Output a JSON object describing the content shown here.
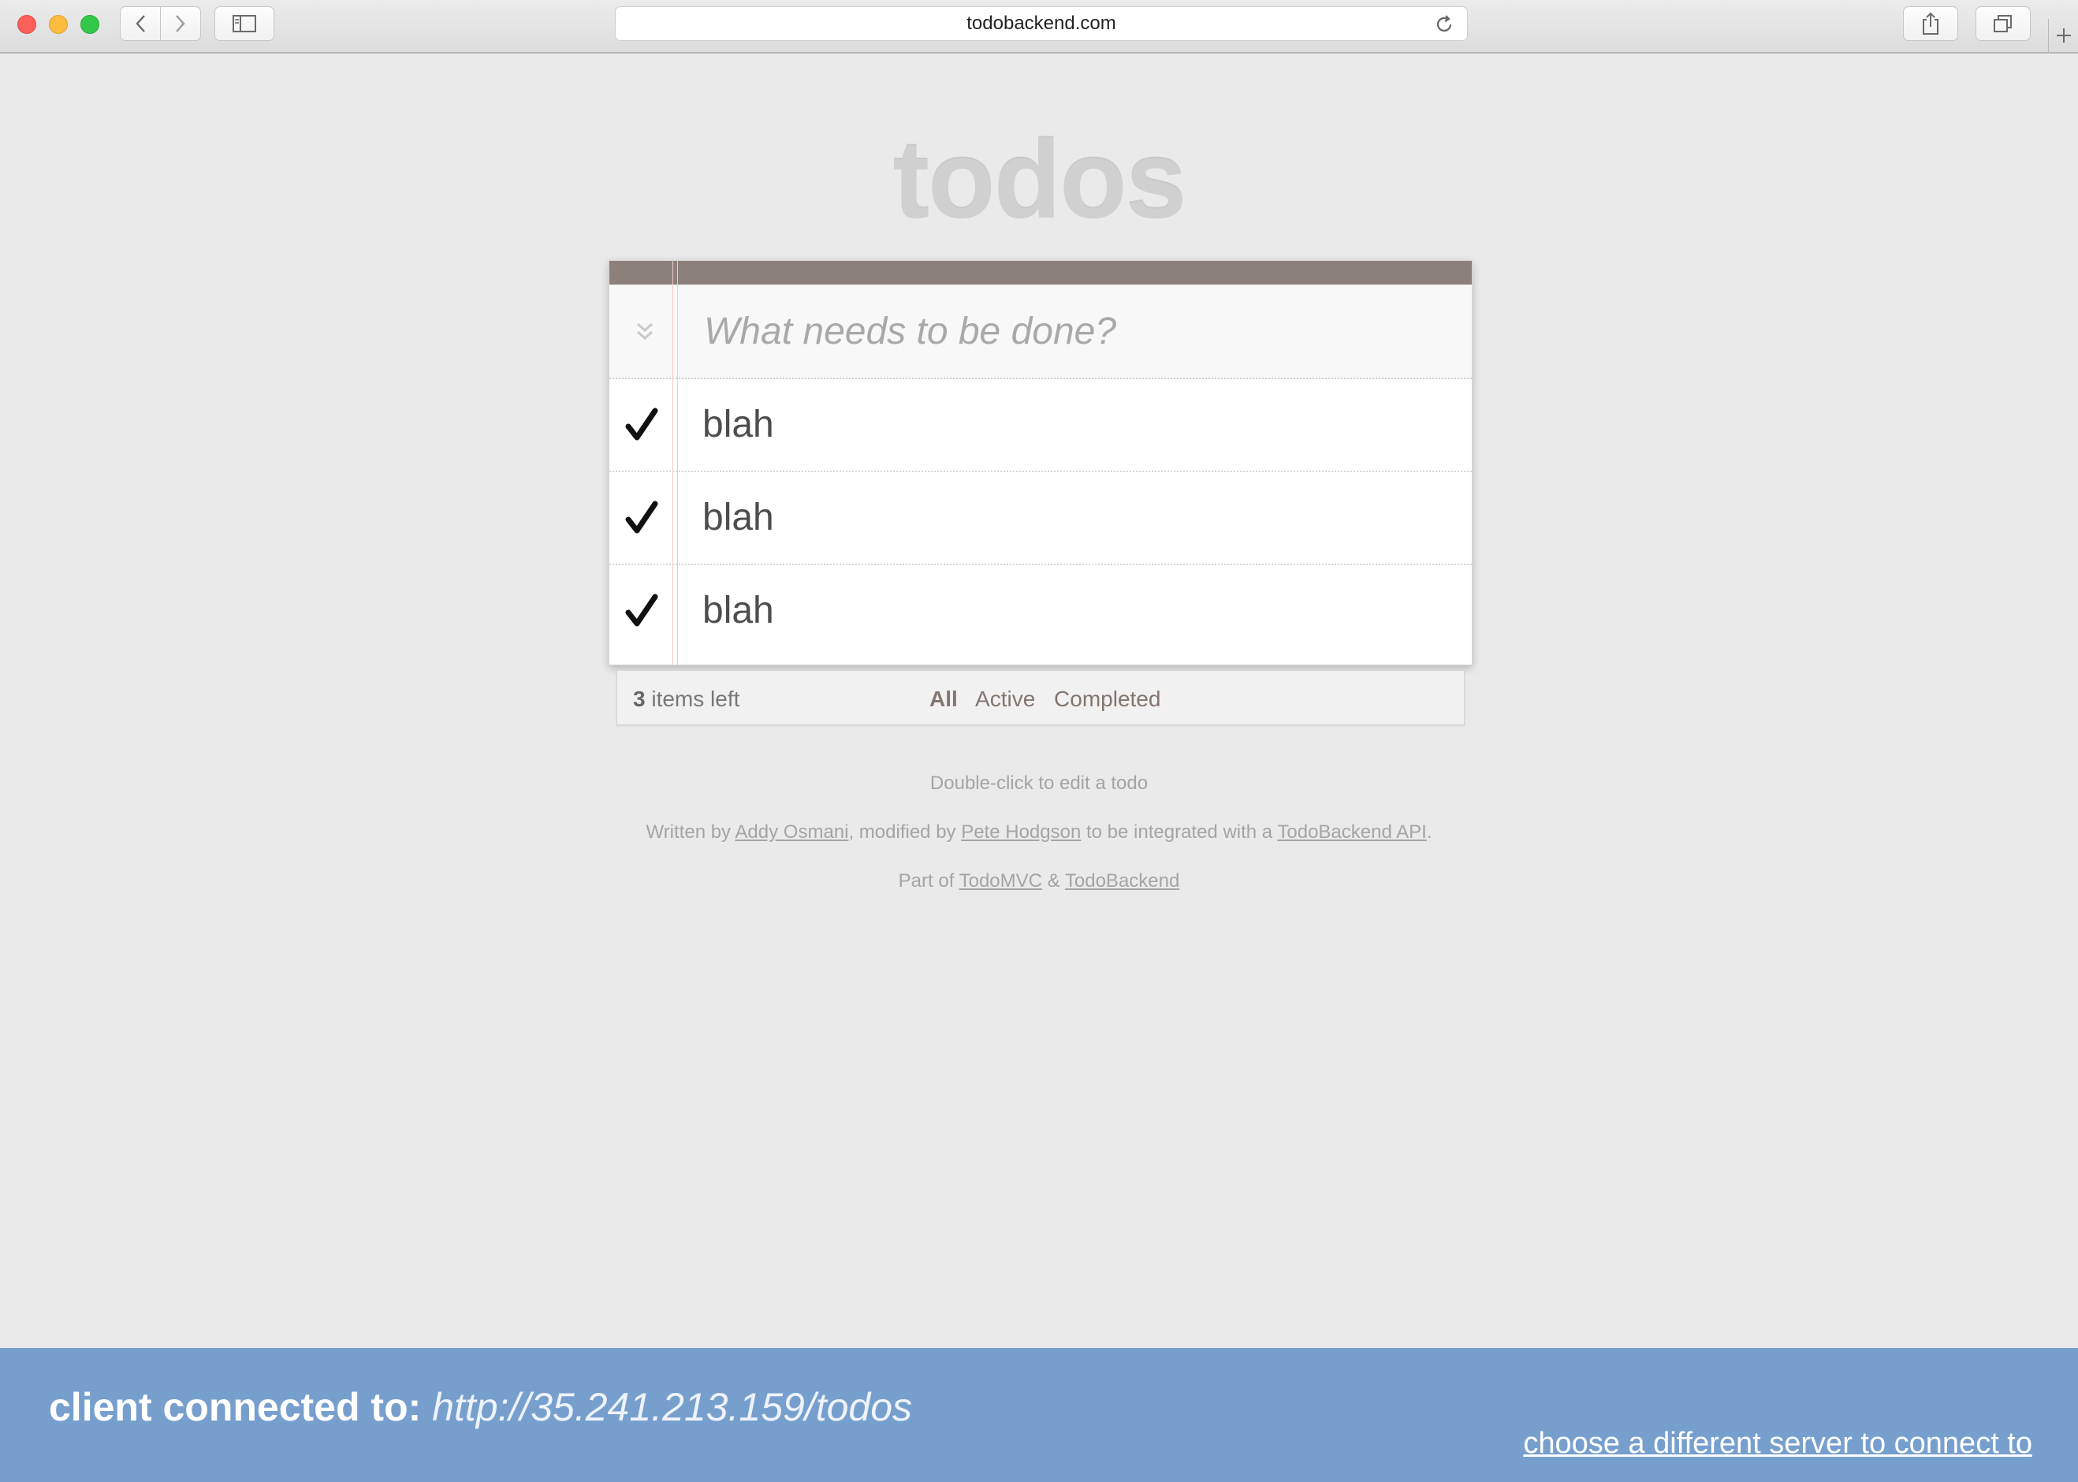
{
  "browser": {
    "url": "todobackend.com"
  },
  "app": {
    "title": "todos",
    "new_todo_placeholder": "What needs to be done?",
    "todos": [
      {
        "label": "blah",
        "completed": true
      },
      {
        "label": "blah",
        "completed": true
      },
      {
        "label": "blah",
        "completed": true
      }
    ],
    "footer": {
      "count": "3",
      "count_suffix": " items left",
      "filters": [
        "All",
        "Active",
        "Completed"
      ],
      "selected_filter": "All"
    }
  },
  "info": {
    "hint": "Double-click to edit a todo",
    "written_by": "Written by ",
    "author1": "Addy Osmani",
    "modified_by": ", modified by ",
    "author2": "Pete Hodgson",
    "integrated": " to be integrated with a ",
    "api_link": "TodoBackend API",
    "period": ".",
    "part_of": "Part of ",
    "todomvc": "TodoMVC",
    "amp": " & ",
    "todobackend": "TodoBackend"
  },
  "banner": {
    "label": "client connected to: ",
    "server_url": "http://35.241.213.159/todos",
    "change_link": "choose a different server to connect to"
  },
  "colors": {
    "banner_bg": "#779fce",
    "topbar": "#8c807a",
    "filter_text": "#83756f"
  }
}
